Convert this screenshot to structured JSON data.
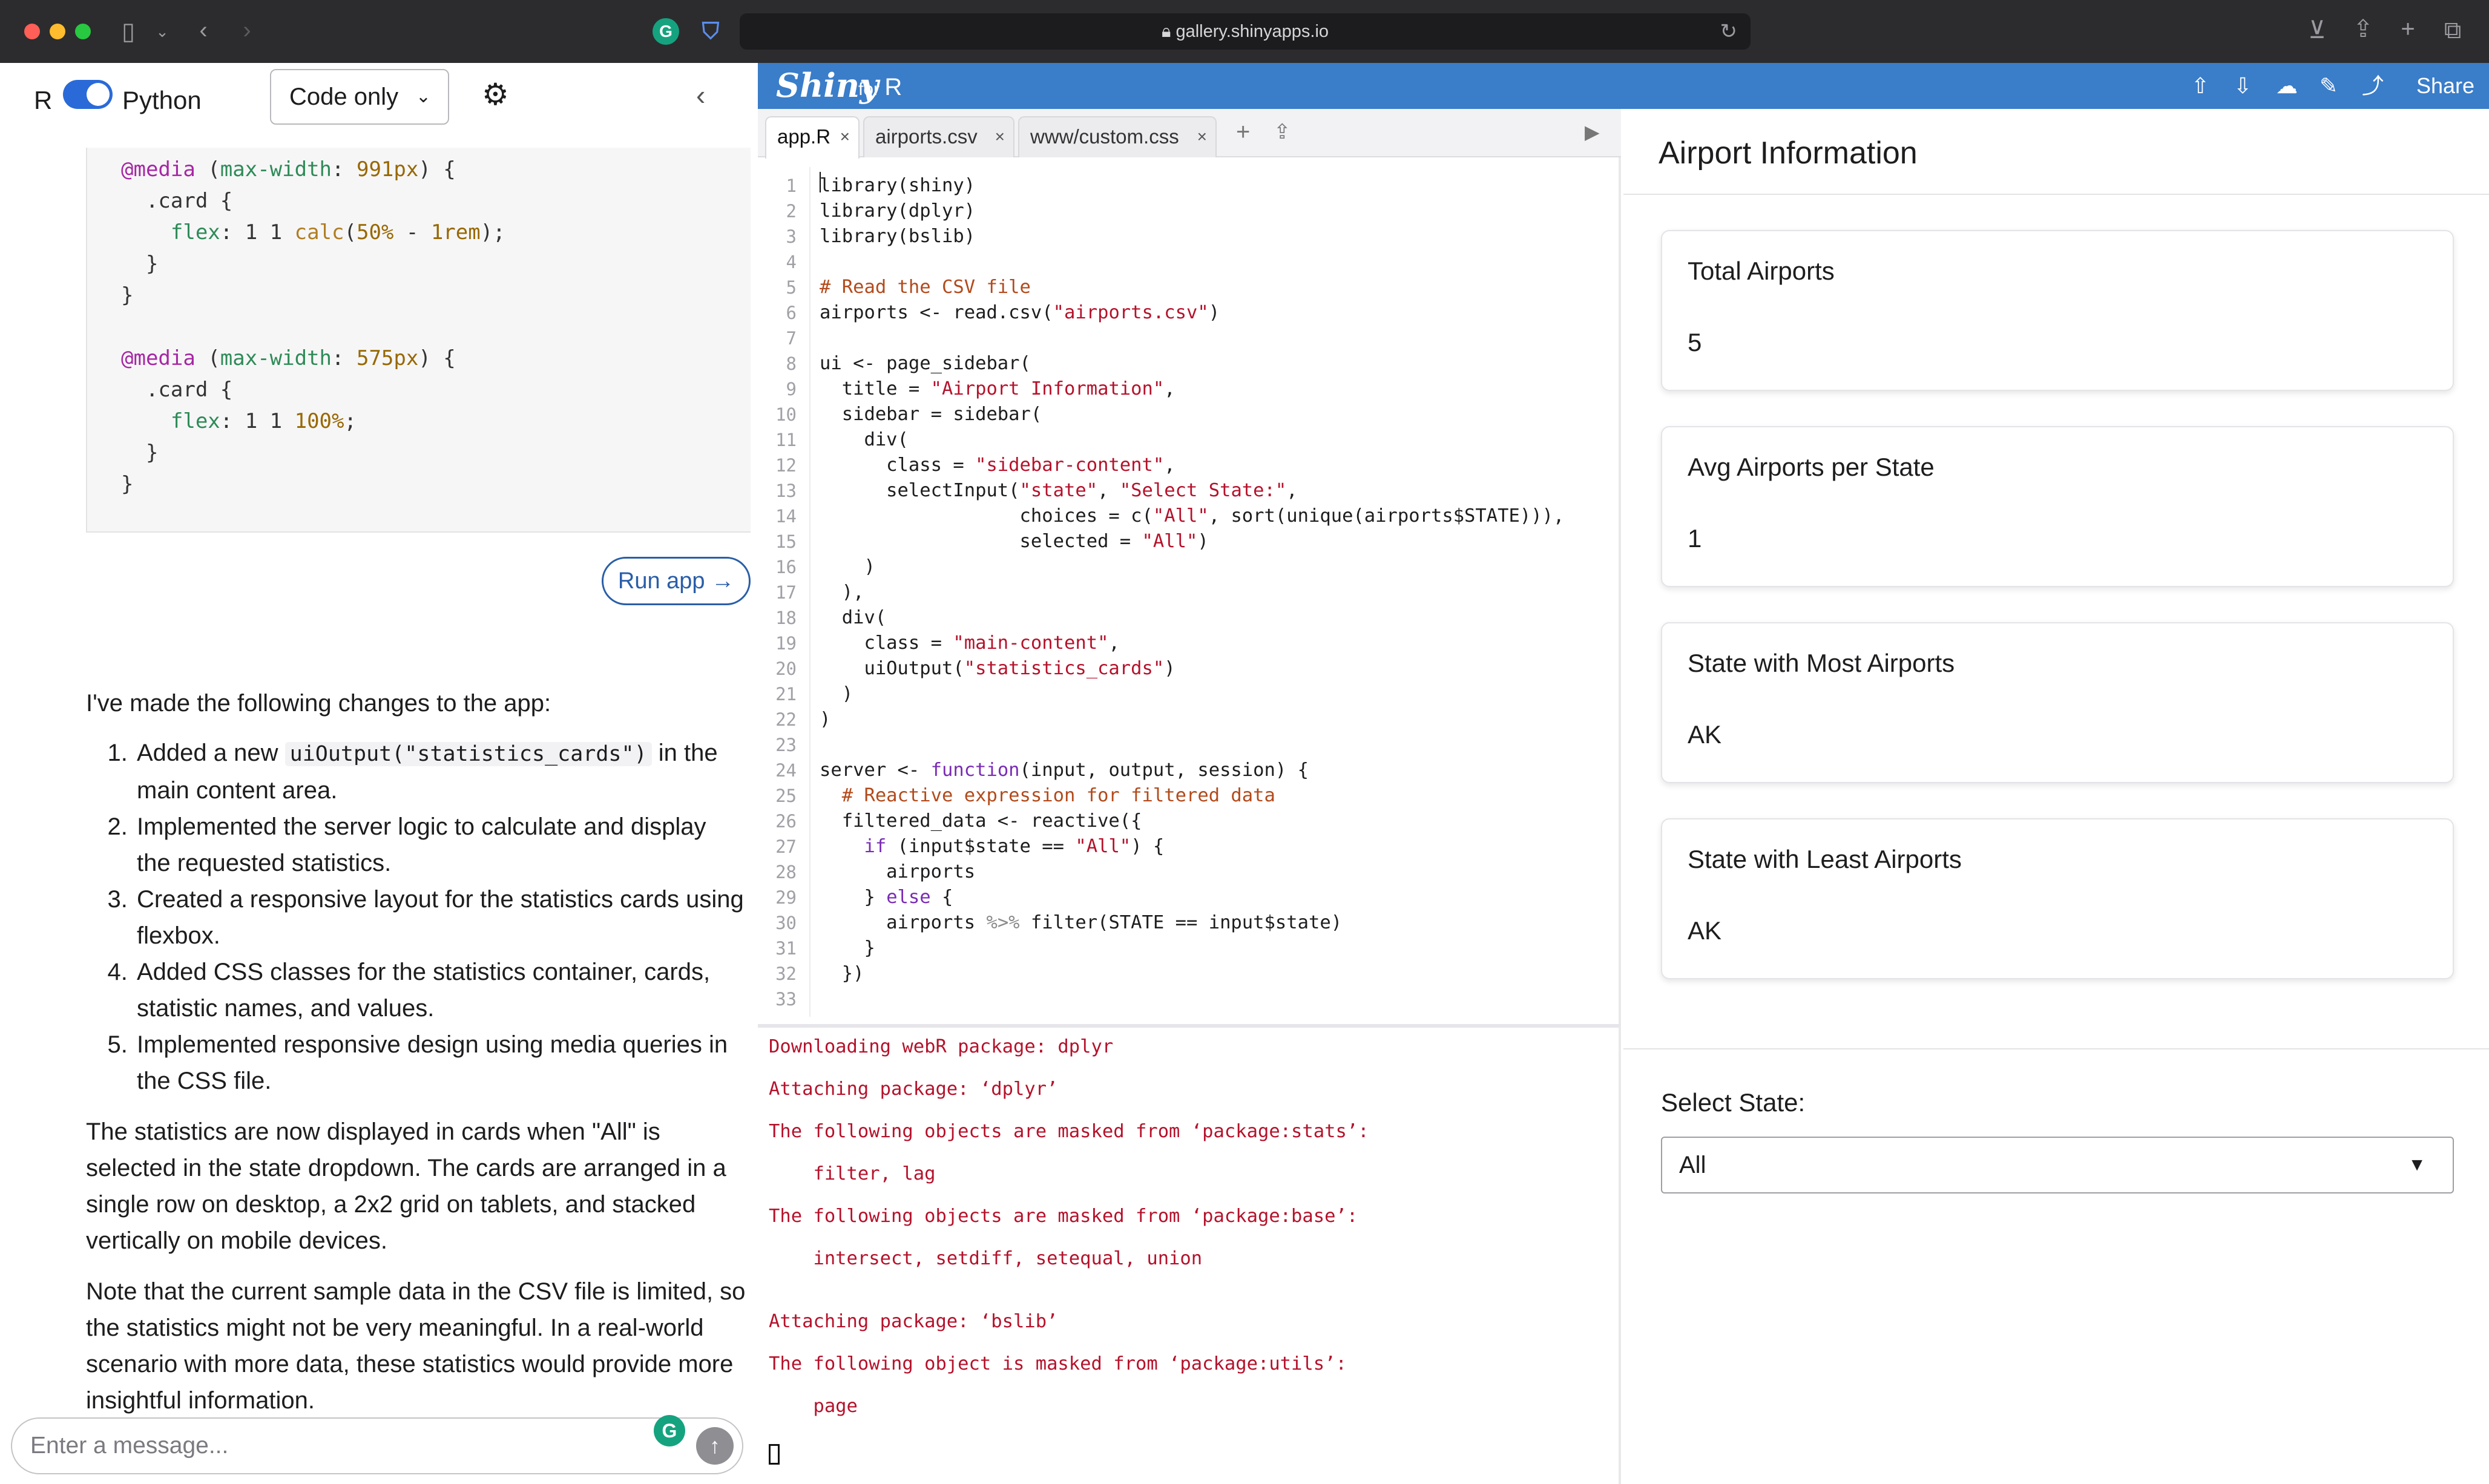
{
  "browser": {
    "url": "gallery.shinyapps.io",
    "icons": [
      "sidebar-icon",
      "chevron-down-icon",
      "back-icon",
      "forward-icon",
      "grammarly-icon",
      "shield-icon",
      "lock-icon",
      "reload-icon",
      "download-icon",
      "share-icon",
      "new-tab-icon",
      "tabs-overview-icon"
    ]
  },
  "left": {
    "lang_r": "R",
    "lang_python": "Python",
    "mode": "Code only",
    "css_lines": [
      "@media (max-width: 991px) {",
      "  .card {",
      "    flex: 1 1 calc(50% - 1rem);",
      "  }",
      "}",
      "",
      "@media (max-width: 575px) {",
      "  .card {",
      "    flex: 1 1 100%;",
      "  }",
      "}"
    ],
    "run_app": "Run app →",
    "intro": "I've made the following changes to the app:",
    "item1_pre": "Added a new ",
    "item1_code": "uiOutput(\"statistics_cards\")",
    "item1_post": " in the main content area.",
    "item2": "Implemented the server logic to calculate and display the requested statistics.",
    "item3": "Created a responsive layout for the statistics cards using flexbox.",
    "item4": "Added CSS classes for the statistics container, cards, statistic names, and values.",
    "item5": "Implemented responsive design using media queries in the CSS file.",
    "para1": "The statistics are now displayed in cards when \"All\" is selected in the state dropdown. The cards are arranged in a single row on desktop, a 2x2 grid on tablets, and stacked vertically on mobile devices.",
    "para2": "Note that the current sample data in the CSV file is limited, so the statistics might not be very meaningful. In a real-world scenario with more data, these statistics would provide more insightful information.",
    "message_placeholder": "Enter a message..."
  },
  "shiny": {
    "logo": "Shiny",
    "for": "for",
    "lang": "R",
    "share": "Share"
  },
  "editor": {
    "tabs": [
      "app.R",
      "airports.csv",
      "www/custom.css"
    ],
    "line_numbers": [
      "1",
      "2",
      "3",
      "4",
      "5",
      "6",
      "7",
      "8",
      "9",
      "10",
      "11",
      "12",
      "13",
      "14",
      "15",
      "16",
      "17",
      "18",
      "19",
      "20",
      "21",
      "22",
      "23",
      "24",
      "25",
      "26",
      "27",
      "28",
      "29",
      "30",
      "31",
      "32",
      "33"
    ]
  },
  "console": {
    "lines": [
      "Downloading webR package: dplyr",
      "Attaching package: ‘dplyr’",
      "The following objects are masked from ‘package:stats’:",
      "    filter, lag",
      "The following objects are masked from ‘package:base’:",
      "    intersect, setdiff, setequal, union",
      "Attaching package: ‘bslib’",
      "The following object is masked from ‘package:utils’:",
      "    page"
    ]
  },
  "app": {
    "title": "Airport Information",
    "cards": [
      {
        "label": "Total Airports",
        "value": "5"
      },
      {
        "label": "Avg Airports per State",
        "value": "1"
      },
      {
        "label": "State with Most Airports",
        "value": "AK"
      },
      {
        "label": "State with Least Airports",
        "value": "AK"
      }
    ],
    "select_label": "Select State:",
    "select_value": "All"
  },
  "colors": {
    "shiny_header": "#3a7dc9",
    "toggle": "#2a6ad8",
    "console_text": "#b5122b",
    "chrome": "#2c2c2e"
  }
}
